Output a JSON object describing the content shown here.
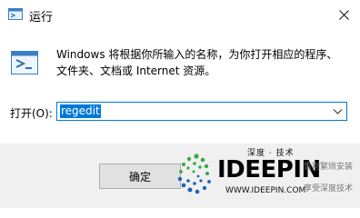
{
  "window": {
    "title": "运行",
    "title_icon": "run-icon",
    "close_icon": "close-icon"
  },
  "content": {
    "description": "Windows 将根据你所输入的名称，为你打开相应的程序、文件夹、文档或 Internet 资源。",
    "open_label": "打开(O):",
    "command_value": "regedit"
  },
  "footer": {
    "ok_label": "确定"
  },
  "watermark": {
    "cn_text": "深度 · 技术",
    "brand": "IDEEPIN",
    "url": "WWW.IDEEPIN.COM",
    "side_text_1": "告别繁琐安装",
    "side_text_2": "享受深度技术"
  },
  "colors": {
    "accent": "#0078d7",
    "footer_bg": "#f0f0f0",
    "watermark_green": "#3aa844",
    "watermark_blue": "#1f5fbf"
  }
}
